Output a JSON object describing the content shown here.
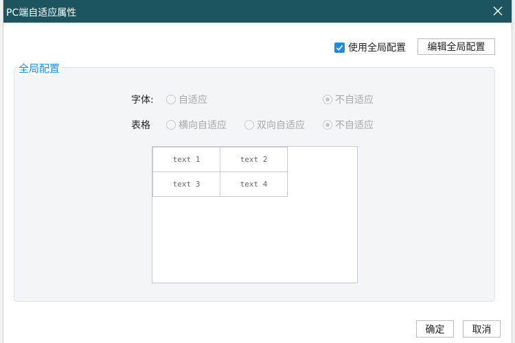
{
  "window": {
    "title": "PC端自适应属性"
  },
  "header": {
    "use_global_label": "使用全局配置",
    "use_global_checked": true,
    "edit_global_label": "编辑全局配置"
  },
  "global_config": {
    "legend": "全局配置",
    "font": {
      "label": "字体:",
      "options": [
        {
          "label": "自适应",
          "checked": false
        },
        {
          "label": "不自适应",
          "checked": true
        }
      ]
    },
    "table": {
      "label": "表格",
      "options": [
        {
          "label": "横向自适应",
          "checked": false
        },
        {
          "label": "双向自适应",
          "checked": false
        },
        {
          "label": "不自适应",
          "checked": true
        }
      ]
    }
  },
  "preview": {
    "cells": [
      "text 1",
      "text 2",
      "text 3",
      "text 4"
    ]
  },
  "footer": {
    "ok_label": "确定",
    "cancel_label": "取消"
  },
  "colors": {
    "titlebar": "#1c545f",
    "accent": "#1d8ce0",
    "disabled_text": "#a8a8a8"
  }
}
